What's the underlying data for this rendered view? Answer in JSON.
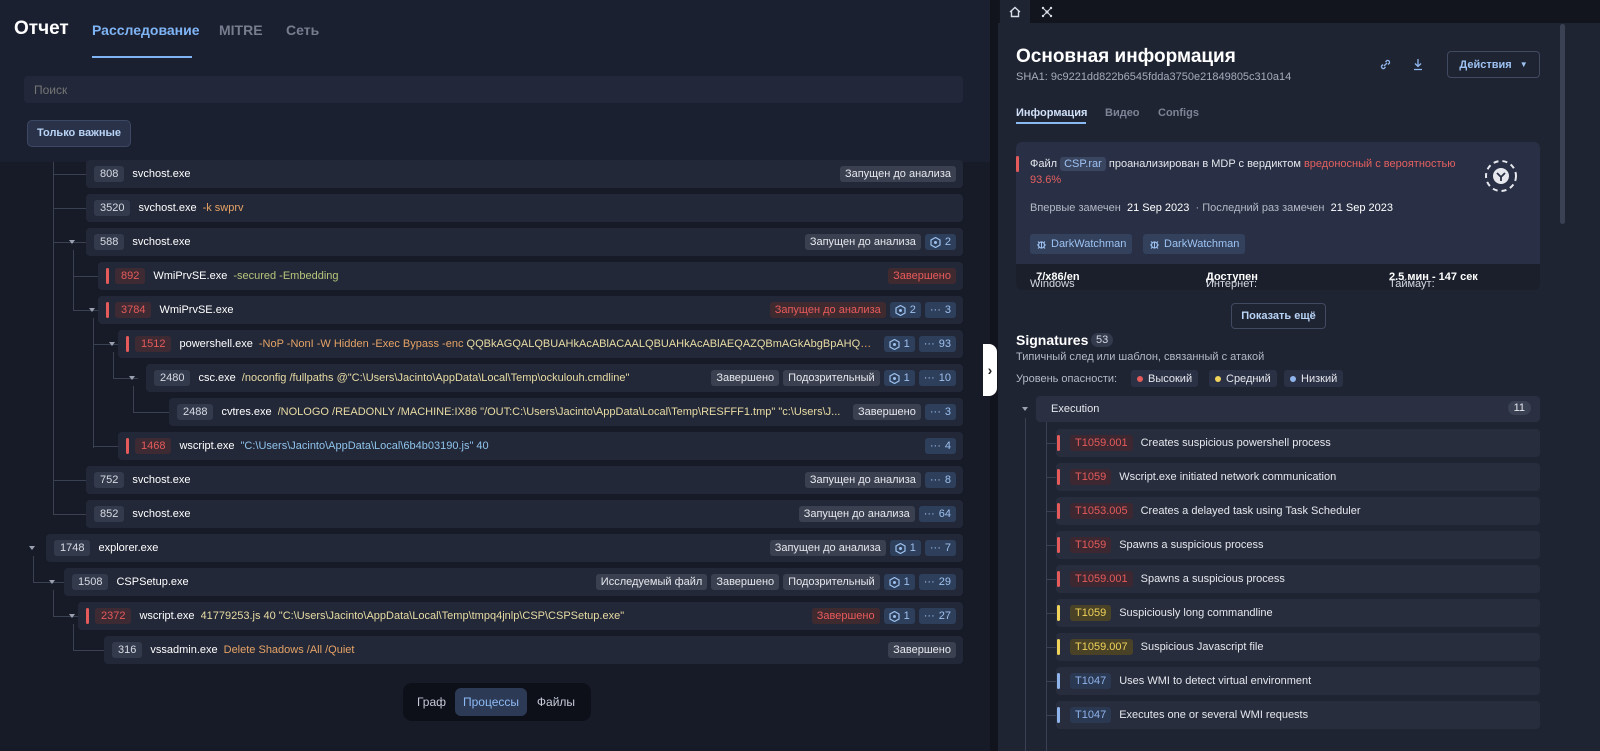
{
  "nav": {
    "title": "Отчет",
    "tabs": [
      "Расследование",
      "MITRE",
      "Сеть"
    ]
  },
  "search": {
    "placeholder": "Поиск"
  },
  "filter": {
    "only_important": "Только важные"
  },
  "processes": [
    {
      "pid": "808",
      "name": "svchost.exe",
      "args": "",
      "tags": [
        "Запущен до анализа"
      ],
      "counts": []
    },
    {
      "pid": "3520",
      "name": "svchost.exe",
      "args": "-k swprv",
      "tags": [],
      "counts": []
    },
    {
      "pid": "588",
      "name": "svchost.exe",
      "args": "",
      "tags": [
        "Запущен до анализа"
      ],
      "counts": [
        "2"
      ]
    },
    {
      "pid": "892",
      "name": "WmiPrvSE.exe",
      "args": "-secured -Embedding",
      "tags": [
        "Завершено"
      ],
      "counts": []
    },
    {
      "pid": "3784",
      "name": "WmiPrvSE.exe",
      "args": "",
      "tags": [
        "Запущен до анализа"
      ],
      "counts": [
        "2",
        "3"
      ]
    },
    {
      "pid": "1512",
      "name": "powershell.exe",
      "args": "-NoP -NonI -W Hidden -Exec Bypass -enc",
      "args2": "QQBkAGQALQBUAHkAcABlACAALQBUAHkAcABlAEQAZQBmAGkAbgBpAHQAaQ...",
      "tags": [],
      "counts": [
        "1",
        "93"
      ]
    },
    {
      "pid": "2480",
      "name": "csc.exe",
      "args": "/noconfig /fullpaths @\"C:\\Users\\Jacinto\\AppData\\Local\\Temp\\ockulouh.cmdline\"",
      "tags": [
        "Завершено",
        "Подозрительный"
      ],
      "counts": [
        "1",
        "10"
      ]
    },
    {
      "pid": "2488",
      "name": "cvtres.exe",
      "args": "/NOLOGO /READONLY /MACHINE:IX86 \"/OUT:C:\\Users\\Jacinto\\AppData\\Local\\Temp\\RESFFF1.tmp\" \"c:\\Users\\J...",
      "tags": [
        "Завершено"
      ],
      "counts": [
        "3"
      ]
    },
    {
      "pid": "1468",
      "name": "wscript.exe",
      "args": "\"C:\\Users\\Jacinto\\AppData\\Local\\6b4b03190.js\" 40",
      "tags": [],
      "counts": [
        "4"
      ]
    },
    {
      "pid": "752",
      "name": "svchost.exe",
      "args": "",
      "tags": [
        "Запущен до анализа"
      ],
      "counts": [
        "8"
      ]
    },
    {
      "pid": "852",
      "name": "svchost.exe",
      "args": "",
      "tags": [
        "Запущен до анализа"
      ],
      "counts": [
        "64"
      ]
    },
    {
      "pid": "1748",
      "name": "explorer.exe",
      "args": "",
      "tags": [
        "Запущен до анализа"
      ],
      "counts": [
        "1",
        "7"
      ]
    },
    {
      "pid": "1508",
      "name": "CSPSetup.exe",
      "args": "",
      "tags": [
        "Исследуемый файл",
        "Завершено",
        "Подозрительный"
      ],
      "counts": [
        "1",
        "29"
      ]
    },
    {
      "pid": "2372",
      "name": "wscript.exe",
      "args": "41779253.js 40 \"C:\\Users\\Jacinto\\AppData\\Local\\Temp\\tmpq4jnlp\\CSP\\CSPSetup.exe\"",
      "tags": [
        "Завершено"
      ],
      "counts": [
        "1",
        "27"
      ]
    },
    {
      "pid": "316",
      "name": "vssadmin.exe",
      "args": "Delete Shadows /All /Quiet",
      "tags": [
        "Завершено"
      ],
      "counts": []
    }
  ],
  "viewtabs": [
    "Граф",
    "Процессы",
    "Файлы"
  ],
  "panel": {
    "title": "Основная информация",
    "sha": "SHA1: 9c9221dd822b6545fdda3750e21849805c310a14",
    "actions": "Действия",
    "tabs": [
      "Информация",
      "Видео",
      "Configs"
    ],
    "verdict_pre": "Файл",
    "file": "CSP.rar",
    "verdict_mid": "проанализирован в MDP с вердиктом",
    "verdict_red": "вредоносный с вероятностью 93.6%",
    "first_seen_label": "Впервые замечен",
    "first_seen": "21 Sep 2023",
    "last_seen_label": "· Последний раз замечен",
    "last_seen": "21 Sep 2023",
    "badges": [
      "DarkWatchman",
      "DarkWatchman"
    ],
    "os_label": "Windows",
    "os": "7/x86/en",
    "inet_label": "Интернет:",
    "inet": "Доступен",
    "timeout_label": "Таймаут:",
    "timeout": "2.5 мин - 147 сек",
    "show_more": "Показать ещё"
  },
  "signatures": {
    "title": "Signatures",
    "count": "53",
    "desc": "Типичный след или шаблон, связанный с атакой",
    "danger_label": "Уровень опасности:",
    "levels": [
      {
        "label": "Высокий",
        "color": "#e55b5b"
      },
      {
        "label": "Средний",
        "color": "#f0d35a"
      },
      {
        "label": "Низкий",
        "color": "#8fb4ec"
      }
    ],
    "group": "Execution",
    "group_count": "11",
    "items": [
      {
        "id": "T1059.001",
        "text": "Creates suspicious powershell process",
        "level": "red"
      },
      {
        "id": "T1059",
        "text": "Wscript.exe initiated network communication",
        "level": "red"
      },
      {
        "id": "T1053.005",
        "text": "Creates a delayed task using Task Scheduler",
        "level": "red"
      },
      {
        "id": "T1059",
        "text": "Spawns a suspicious process",
        "level": "red"
      },
      {
        "id": "T1059.001",
        "text": "Spawns a suspicious process",
        "level": "red"
      },
      {
        "id": "T1059",
        "text": "Suspiciously long commandline",
        "level": "yel"
      },
      {
        "id": "T1059.007",
        "text": "Suspicious Javascript file",
        "level": "yel"
      },
      {
        "id": "T1047",
        "text": "Uses WMI to detect virtual environment",
        "level": "blu"
      },
      {
        "id": "T1047",
        "text": "Executes one or several WMI requests",
        "level": "blu"
      }
    ]
  }
}
